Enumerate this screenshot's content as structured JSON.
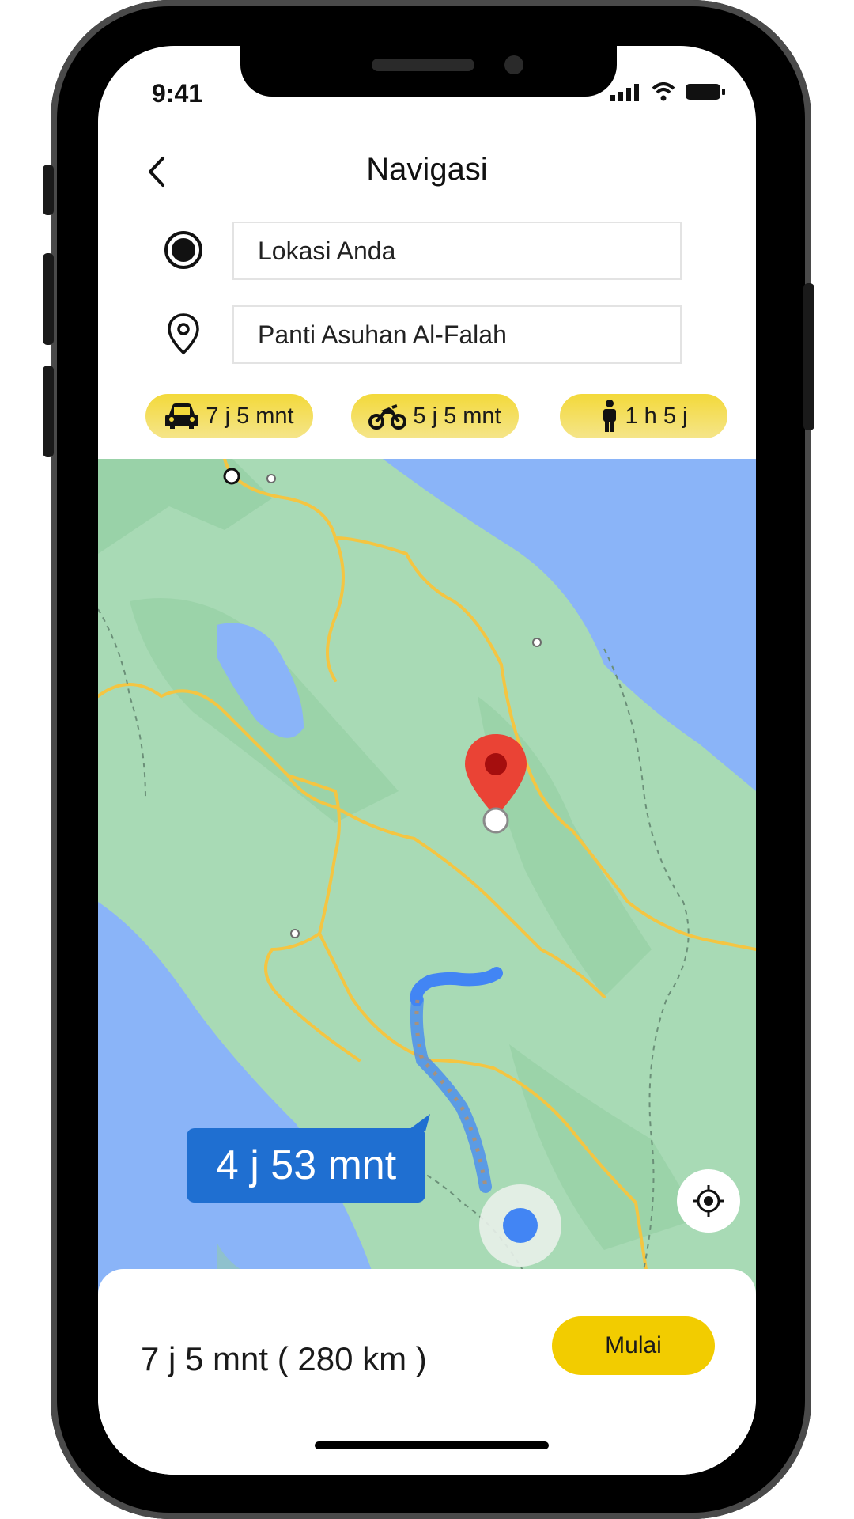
{
  "status_bar": {
    "time": "9:41"
  },
  "header": {
    "title": "Navigasi",
    "back_icon": "chevron-left-icon"
  },
  "route_inputs": {
    "origin": {
      "value": "Lokasi Anda",
      "icon": "current-location-dot-icon"
    },
    "destination": {
      "value": "Panti Asuhan Al-Falah",
      "icon": "map-pin-outline-icon"
    }
  },
  "transport_modes": [
    {
      "mode": "car",
      "icon": "car-icon",
      "label": "7 j 5 mnt"
    },
    {
      "mode": "motorcycle",
      "icon": "motorcycle-icon",
      "label": "5 j 5 mnt"
    },
    {
      "mode": "walk",
      "icon": "walking-person-icon",
      "label": "1 h 5 j"
    }
  ],
  "map": {
    "route_eta_badge": "4 j 53 mnt",
    "colors": {
      "water": "#8ab4f8",
      "land": "#a8dab5",
      "road": "#f4c542",
      "route": "#4285f4",
      "pin": "#ea4335"
    }
  },
  "bottom_sheet": {
    "summary": "7 j 5 mnt ( 280 km )",
    "start_label": "Mulai"
  },
  "colors": {
    "accent": "#f2cc00",
    "badge": "#1f6fd1"
  }
}
